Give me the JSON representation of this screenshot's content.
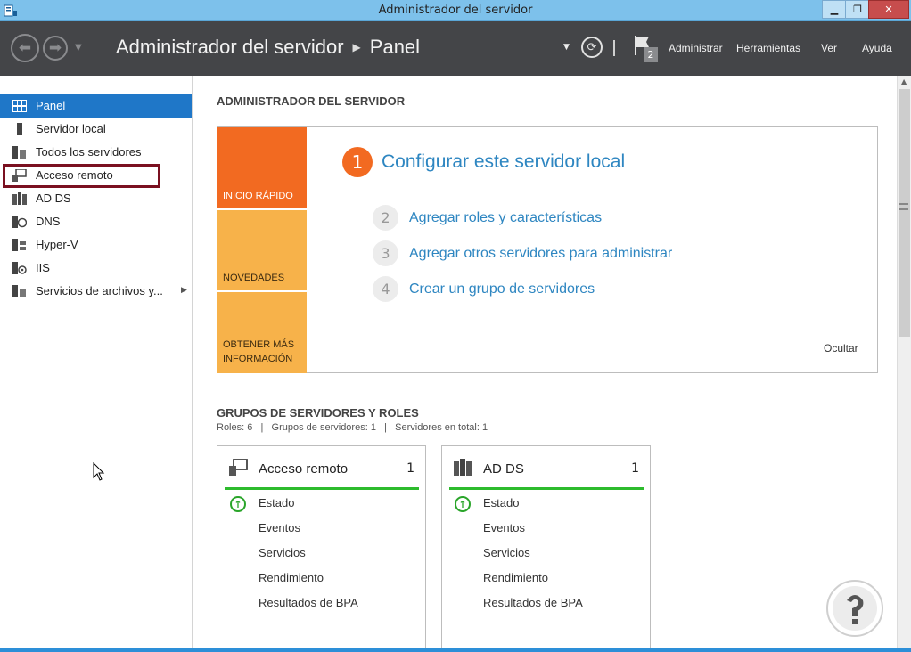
{
  "window": {
    "title": "Administrador del servidor",
    "minimize_icon": "minimize-icon",
    "maximize_icon": "restore-icon",
    "close_icon": "close-icon"
  },
  "header": {
    "breadcrumb_root": "Administrador del servidor",
    "breadcrumb_current": "Panel",
    "notifications_count": "2",
    "menu": {
      "administrar": "Administrar",
      "herramientas": "Herramientas",
      "ver": "Ver",
      "ayuda": "Ayuda"
    }
  },
  "sidebar": {
    "items": [
      {
        "label": "Panel",
        "icon": "dashboard-icon",
        "active": true
      },
      {
        "label": "Servidor local",
        "icon": "server-icon"
      },
      {
        "label": "Todos los servidores",
        "icon": "servers-icon"
      },
      {
        "label": "Acceso remoto",
        "icon": "remote-access-icon"
      },
      {
        "label": "AD DS",
        "icon": "ad-ds-icon"
      },
      {
        "label": "DNS",
        "icon": "dns-icon"
      },
      {
        "label": "Hyper-V",
        "icon": "hyper-v-icon"
      },
      {
        "label": "IIS",
        "icon": "iis-icon"
      },
      {
        "label": "Servicios de archivos y...",
        "icon": "file-services-icon",
        "has_submenu": true
      }
    ]
  },
  "main": {
    "section_title": "ADMINISTRADOR DEL SERVIDOR",
    "quick_start": {
      "tiles": {
        "inicio_rapido": "INICIO RÁPIDO",
        "novedades": "NOVEDADES",
        "obtener_mas_l1": "OBTENER MÁS",
        "obtener_mas_l2": "INFORMACIÓN"
      },
      "step1": {
        "num": "1",
        "label": "Configurar este servidor local"
      },
      "step2": {
        "num": "2",
        "label": "Agregar roles y características"
      },
      "step3": {
        "num": "3",
        "label": "Agregar otros servidores para administrar"
      },
      "step4": {
        "num": "4",
        "label": "Crear un grupo de servidores"
      },
      "hide": "Ocultar"
    },
    "groups_title": "GRUPOS DE SERVIDORES Y ROLES",
    "summary": "Roles: 6   |   Grupos de servidores: 1   |   Servidores en total: 1",
    "cards": [
      {
        "title": "Acceso remoto",
        "count": "1",
        "rows": [
          "Estado",
          "Eventos",
          "Servicios",
          "Rendimiento",
          "Resultados de BPA"
        ]
      },
      {
        "title": "AD DS",
        "count": "1",
        "rows": [
          "Estado",
          "Eventos",
          "Servicios",
          "Rendimiento",
          "Resultados de BPA"
        ]
      }
    ]
  },
  "colors": {
    "header_bg": "#444548",
    "active_item": "#1f77c8",
    "quick_start_orange": "#f26a21",
    "quick_start_light": "#f7b24a",
    "link_blue": "#2e86c1",
    "status_green": "#2dbb2d",
    "highlight_box": "#7a1020"
  }
}
